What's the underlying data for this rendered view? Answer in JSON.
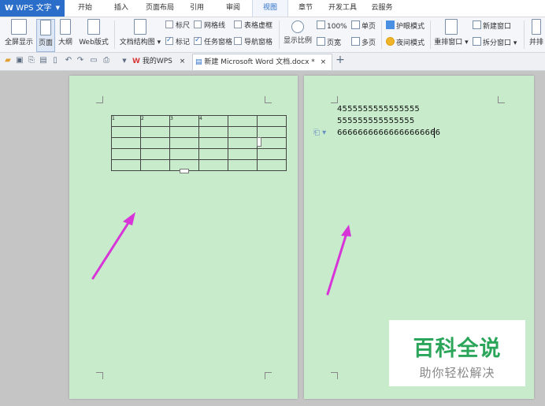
{
  "app": {
    "name": "WPS 文字",
    "logo": "W"
  },
  "menu": {
    "items": [
      "开始",
      "插入",
      "页面布局",
      "引用",
      "审阅",
      "视图",
      "章节",
      "开发工具",
      "云服务"
    ],
    "active": "视图"
  },
  "ribbon": {
    "fullscreen": "全屏显示",
    "page": "页面",
    "outline": "大纲",
    "web": "Web版式",
    "doc_structure": "文档结构图",
    "ruler": "标尺",
    "gridlines": "网格线",
    "table_gridlines": "表格虚框",
    "marks": "标记",
    "task_pane": "任务窗格",
    "nav_pane": "导航窗格",
    "zoom_ratio": "显示比例",
    "zoom_100": "100%",
    "page_width": "页宽",
    "single_page": "单页",
    "multi_page": "多页",
    "eye_mode": "护眼模式",
    "night_mode": "夜间模式",
    "rearrange": "重排窗口",
    "new_window": "新建窗口",
    "split_window": "拆分窗口",
    "side_by_side": "并排"
  },
  "tabs": {
    "mywps": "我的WPS",
    "doc": "新建 Microsoft Word 文档.docx *",
    "close": "×",
    "add": "+"
  },
  "table": {
    "rows": [
      [
        "1",
        "2",
        "3",
        "4",
        "",
        ""
      ],
      [
        "",
        "",
        "",
        "",
        "",
        ""
      ],
      [
        "",
        "",
        "",
        "",
        "",
        ""
      ],
      [
        "",
        "",
        "",
        "",
        "",
        ""
      ],
      [
        "",
        "",
        "",
        "",
        "",
        ""
      ]
    ]
  },
  "page2": {
    "lines": [
      "4555555555555555",
      "555555555555555",
      "66666666666666666666"
    ]
  },
  "watermark": {
    "title": "百科全说",
    "subtitle": "助你轻松解决"
  },
  "colors": {
    "page_bg": "#c8ebcc",
    "arrow": "#d735d8",
    "accent": "#2b6ec9",
    "watermark_green": "#2aa55a"
  }
}
